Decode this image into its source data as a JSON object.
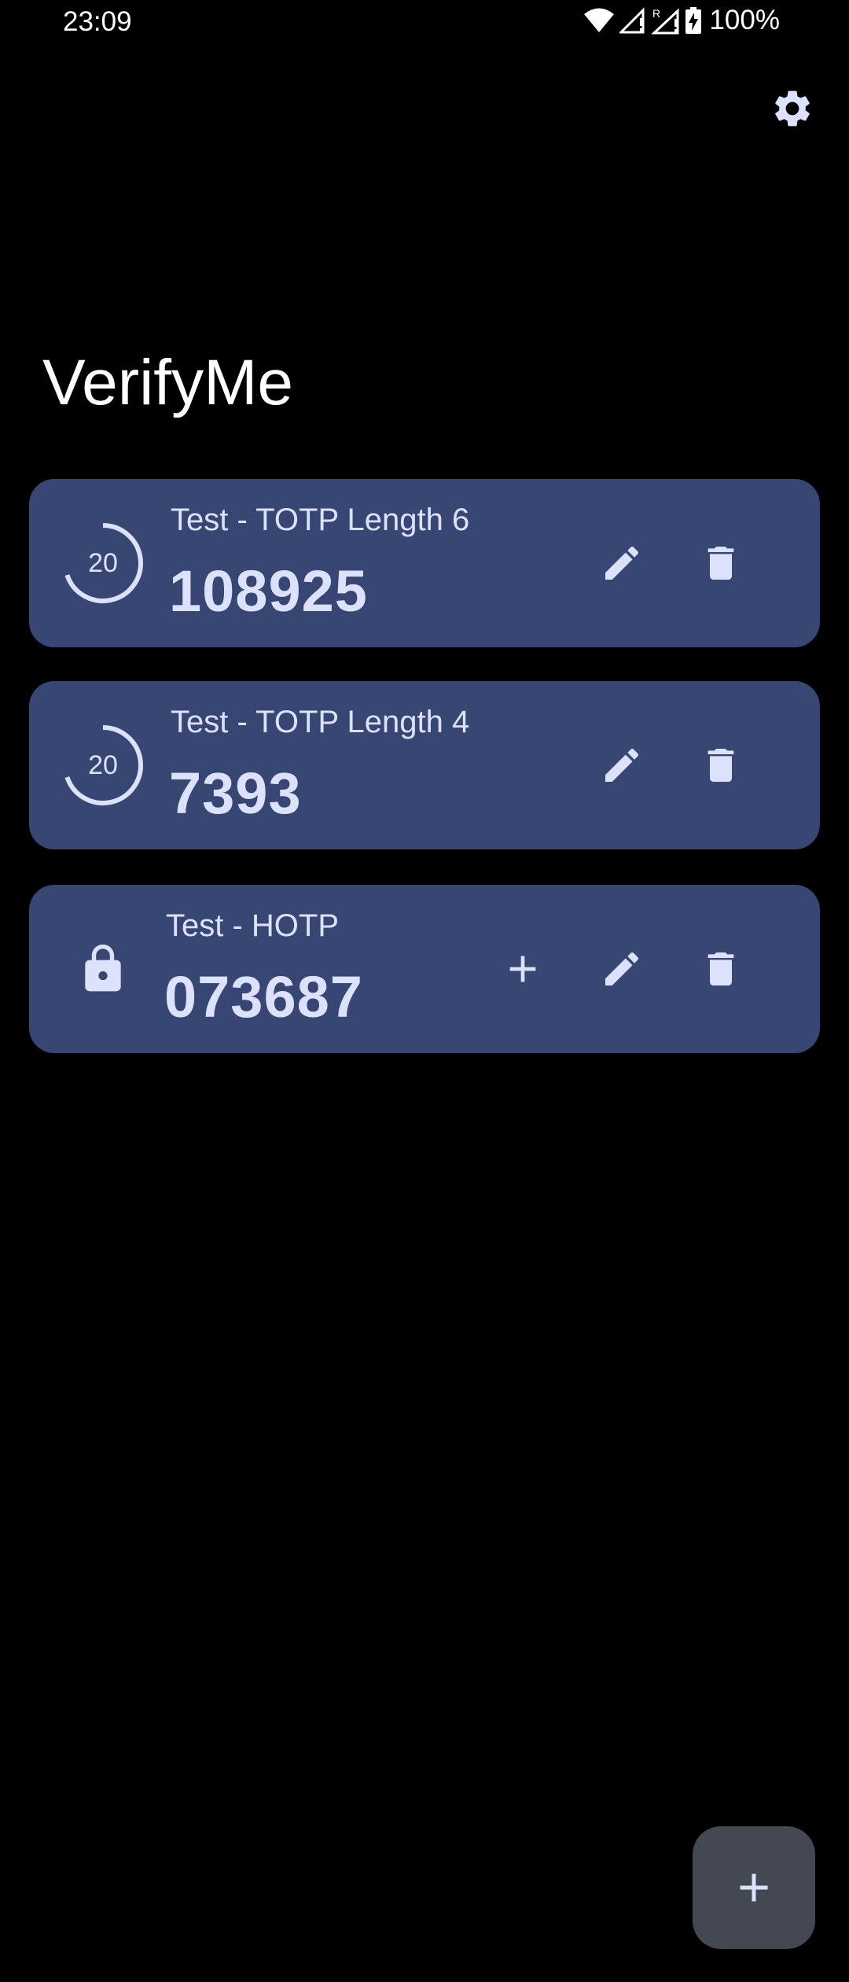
{
  "status_bar": {
    "time": "23:09",
    "battery": "100%",
    "icons": [
      "wifi-icon",
      "signal-icon",
      "signal-roaming-icon",
      "battery-charging-icon"
    ]
  },
  "header": {
    "title": "VerifyMe",
    "settings_icon": "gear-icon"
  },
  "tokens": [
    {
      "name": "Test - TOTP Length 6",
      "code": "108925",
      "type": "TOTP",
      "seconds_remaining": "20"
    },
    {
      "name": "Test - TOTP Length 4",
      "code": "7393",
      "type": "TOTP",
      "seconds_remaining": "20"
    },
    {
      "name": "Test - HOTP",
      "code": "073687",
      "type": "HOTP"
    }
  ],
  "fab": {
    "icon": "plus-icon"
  },
  "colors": {
    "background": "#000000",
    "card": "#374673",
    "card_text": "#dce2fb",
    "fab": "#434853"
  }
}
